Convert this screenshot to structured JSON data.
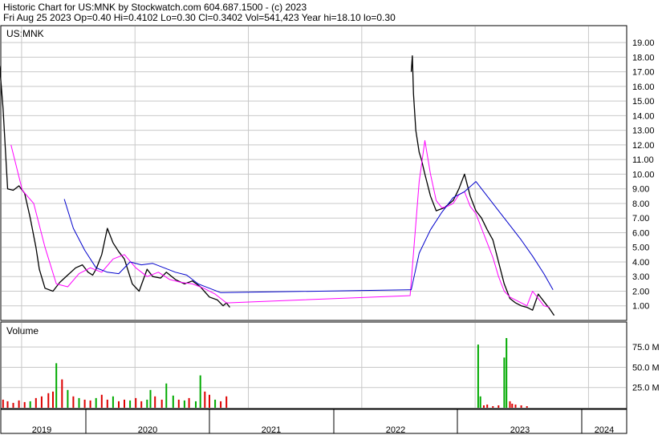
{
  "header": {
    "line1": "Historic Chart for US:MNK by Stockwatch.com 604.687.1500 - (c) 2023",
    "line2": "Fri Aug 25 2023  Op=0.40  Hi=0.4102  Lo=0.30  Cl=0.3402  Vol=541,423  Year hi=18.10  lo=0.30"
  },
  "colors": {
    "price": "#000000",
    "ma_short": "#ff00ff",
    "ma_long": "#0000cc",
    "vol_up": "#00aa00",
    "vol_down": "#dd0000",
    "grid": "#c8c8c8",
    "border": "#000000"
  },
  "chart_data": [
    {
      "type": "line",
      "title": "US:MNK",
      "x_axis_labels": [
        "2019",
        "2020",
        "2021",
        "2022",
        "2023",
        "2024"
      ],
      "y_ticks": [
        "1.00",
        "2.00",
        "3.00",
        "4.00",
        "5.00",
        "6.00",
        "7.00",
        "8.00",
        "9.00",
        "10.00",
        "11.00",
        "12.00",
        "13.00",
        "14.00",
        "15.00",
        "16.00",
        "17.00",
        "18.00",
        "19.00"
      ],
      "ylim": [
        0,
        19.5
      ],
      "grid": true,
      "series": [
        {
          "color": "#000000",
          "x": [
            2018.75,
            2018.78,
            2018.82,
            2018.87,
            2018.92,
            2018.97,
            2019.02,
            2019.07,
            2019.1,
            2019.15,
            2019.22,
            2019.28,
            2019.35,
            2019.42,
            2019.48,
            2019.53,
            2019.57,
            2019.6,
            2019.65,
            2019.7,
            2019.75,
            2019.8,
            2019.85,
            2019.92,
            2019.98,
            2020.05,
            2020.1,
            2020.17,
            2020.22,
            2020.3,
            2020.38,
            2020.45,
            2020.52,
            2020.6,
            2020.67,
            2020.72,
            2020.75,
            2020.78,
            2022.38,
            2022.39,
            2022.4,
            2022.42,
            2022.45,
            2022.47,
            2022.5,
            2022.55,
            2022.6,
            2022.67,
            2022.75,
            2022.8,
            2022.85,
            2022.9,
            2022.95,
            2023.0,
            2023.05,
            2023.1,
            2023.15,
            2023.2,
            2023.25,
            2023.3,
            2023.35,
            2023.4,
            2023.45,
            2023.5,
            2023.55,
            2023.6,
            2023.64
          ],
          "values": [
            17.4,
            14.5,
            9.0,
            8.9,
            9.2,
            8.7,
            7.0,
            5.0,
            3.5,
            2.2,
            2.0,
            2.6,
            3.1,
            3.6,
            3.8,
            3.3,
            3.1,
            3.5,
            4.5,
            6.3,
            5.3,
            4.7,
            4.2,
            2.5,
            2.0,
            3.5,
            3.0,
            2.9,
            3.3,
            2.8,
            2.5,
            2.7,
            2.3,
            1.6,
            1.4,
            1.0,
            1.2,
            0.9,
            17.0,
            18.1,
            15.5,
            13.0,
            11.5,
            11.0,
            10.0,
            8.5,
            7.5,
            7.7,
            8.2,
            9.0,
            10.0,
            8.5,
            7.5,
            7.0,
            6.2,
            5.5,
            4.0,
            2.5,
            1.5,
            1.2,
            1.0,
            0.9,
            0.7,
            1.8,
            1.3,
            0.8,
            0.34
          ]
        },
        {
          "color": "#ff00ff",
          "x": [
            2018.85,
            2018.95,
            2019.05,
            2019.15,
            2019.25,
            2019.35,
            2019.45,
            2019.55,
            2019.65,
            2019.75,
            2019.85,
            2019.95,
            2020.05,
            2020.15,
            2020.25,
            2020.35,
            2020.45,
            2020.55,
            2020.65,
            2020.75,
            2022.37,
            2022.45,
            2022.5,
            2022.55,
            2022.6,
            2022.65,
            2022.7,
            2022.75,
            2022.8,
            2022.85,
            2022.9,
            2022.95,
            2023.0,
            2023.05,
            2023.1,
            2023.15,
            2023.2,
            2023.25,
            2023.3,
            2023.35,
            2023.4,
            2023.45,
            2023.5,
            2023.55,
            2023.6
          ],
          "values": [
            12.0,
            8.9,
            8.0,
            5.0,
            2.5,
            2.3,
            3.2,
            3.6,
            3.3,
            4.2,
            4.5,
            3.6,
            3.0,
            3.3,
            2.8,
            2.6,
            2.5,
            2.2,
            1.8,
            1.2,
            1.7,
            9.5,
            12.3,
            10.0,
            8.2,
            7.7,
            7.8,
            8.0,
            8.6,
            8.8,
            7.8,
            7.3,
            6.3,
            5.3,
            4.3,
            3.0,
            2.0,
            1.6,
            1.4,
            1.2,
            1.0,
            2.0,
            1.5,
            1.0,
            0.9
          ]
        },
        {
          "color": "#0000cc",
          "x": [
            2019.32,
            2019.4,
            2019.5,
            2019.6,
            2019.7,
            2019.8,
            2019.9,
            2020.0,
            2020.1,
            2020.2,
            2020.3,
            2020.4,
            2020.5,
            2020.6,
            2020.7,
            2022.38,
            2022.45,
            2022.55,
            2022.65,
            2022.75,
            2022.85,
            2022.95,
            2023.05,
            2023.15,
            2023.25,
            2023.35,
            2023.45,
            2023.55,
            2023.63
          ],
          "values": [
            8.3,
            6.3,
            4.8,
            3.6,
            3.3,
            3.2,
            4.0,
            3.8,
            3.9,
            3.6,
            3.3,
            3.1,
            2.5,
            2.2,
            1.9,
            2.1,
            4.6,
            6.2,
            7.4,
            8.4,
            8.8,
            9.5,
            8.5,
            7.5,
            6.5,
            5.5,
            4.4,
            3.2,
            2.1
          ]
        }
      ]
    },
    {
      "type": "bar",
      "title": "Volume",
      "y_ticks": [
        "25.0 M",
        "50.0 M",
        "75.0 M"
      ],
      "ylim": [
        0,
        90
      ],
      "grid": true,
      "x": [
        2018.78,
        2018.82,
        2018.87,
        2018.92,
        2018.97,
        2019.02,
        2019.07,
        2019.12,
        2019.18,
        2019.22,
        2019.25,
        2019.3,
        2019.35,
        2019.4,
        2019.45,
        2019.5,
        2019.55,
        2019.6,
        2019.65,
        2019.7,
        2019.75,
        2019.8,
        2019.85,
        2019.9,
        2019.95,
        2020.0,
        2020.05,
        2020.08,
        2020.12,
        2020.18,
        2020.22,
        2020.28,
        2020.33,
        2020.38,
        2020.42,
        2020.48,
        2020.52,
        2020.56,
        2020.6,
        2020.65,
        2020.7,
        2020.75,
        2022.97,
        2022.99,
        2023.02,
        2023.05,
        2023.1,
        2023.15,
        2023.2,
        2023.22,
        2023.25,
        2023.27,
        2023.3,
        2023.35,
        2023.4
      ],
      "values": [
        10,
        8,
        6,
        9,
        7,
        8,
        12,
        14,
        18,
        20,
        55,
        35,
        22,
        14,
        12,
        10,
        9,
        12,
        16,
        10,
        14,
        8,
        10,
        9,
        12,
        8,
        10,
        22,
        14,
        10,
        30,
        15,
        10,
        9,
        12,
        8,
        40,
        20,
        16,
        10,
        8,
        14,
        78,
        14,
        3,
        4,
        2,
        3,
        62,
        86,
        8,
        5,
        4,
        3,
        2
      ],
      "colors_by_bar": [
        "r",
        "r",
        "r",
        "r",
        "r",
        "g",
        "r",
        "r",
        "r",
        "r",
        "g",
        "r",
        "g",
        "r",
        "g",
        "r",
        "r",
        "g",
        "r",
        "r",
        "g",
        "r",
        "r",
        "g",
        "r",
        "r",
        "g",
        "g",
        "r",
        "r",
        "g",
        "g",
        "r",
        "g",
        "r",
        "g",
        "g",
        "r",
        "r",
        "g",
        "r",
        "r",
        "g",
        "g",
        "r",
        "r",
        "r",
        "r",
        "g",
        "g",
        "r",
        "r",
        "r",
        "r",
        "r"
      ]
    }
  ]
}
